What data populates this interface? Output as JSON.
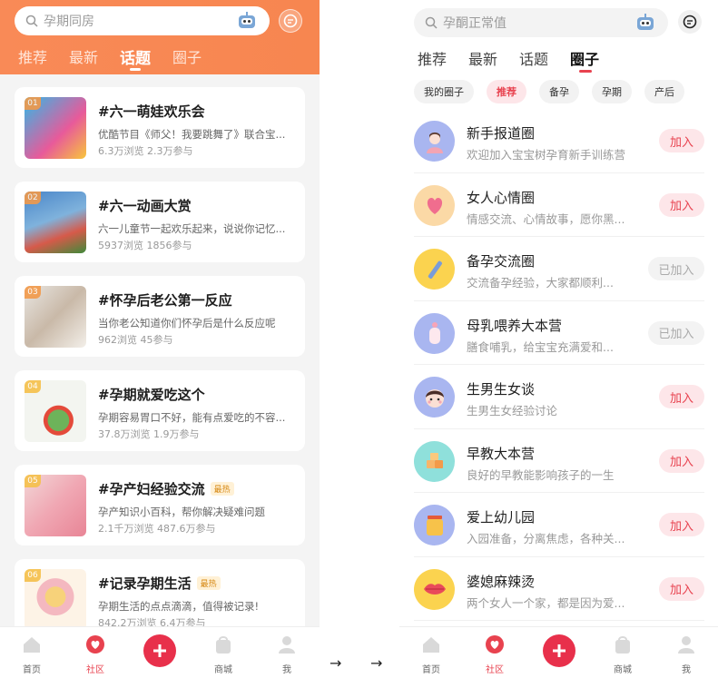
{
  "left": {
    "search_placeholder": "孕期同房",
    "tabs": [
      "推荐",
      "最新",
      "话题",
      "圈子"
    ],
    "topics": [
      {
        "rank": "01",
        "title": "#六一萌娃欢乐会",
        "desc": "优酷节目《师父！我要跳舞了》联合宝...",
        "stats": "6.3万浏览  2.3万参与",
        "badge": ""
      },
      {
        "rank": "02",
        "title": "#六一动画大赏",
        "desc": "六一儿童节一起欢乐起来，说说你记忆...",
        "stats": "5937浏览  1856参与",
        "badge": ""
      },
      {
        "rank": "03",
        "title": "#怀孕后老公第一反应",
        "desc": "当你老公知道你们怀孕后是什么反应呢",
        "stats": "962浏览  45参与",
        "badge": ""
      },
      {
        "rank": "04",
        "title": "#孕期就爱吃这个",
        "desc": "孕期容易胃口不好，能有点爱吃的不容...",
        "stats": "37.8万浏览  1.9万参与",
        "badge": ""
      },
      {
        "rank": "05",
        "title": "#孕产妇经验交流",
        "desc": "孕产知识小百科，帮你解决疑难问题",
        "stats": "2.1千万浏览  487.6万参与",
        "badge": "最热"
      },
      {
        "rank": "06",
        "title": "#记录孕期生活",
        "desc": "孕期生活的点点滴滴，值得被记录!",
        "stats": "842.2万浏览  6.4万参与",
        "badge": "最热"
      }
    ]
  },
  "right": {
    "search_placeholder": "孕酮正常值",
    "tabs": [
      "推荐",
      "最新",
      "话题",
      "圈子"
    ],
    "chips": [
      "我的圈子",
      "推荐",
      "备孕",
      "孕期",
      "产后"
    ],
    "groups": [
      {
        "name": "新手报道圈",
        "desc": "欢迎加入宝宝树孕育新手训练营",
        "button": "加入",
        "avatar": "mom-avatar-icon"
      },
      {
        "name": "女人心情圈",
        "desc": "情感交流、心情故事，愿你黑...",
        "button": "加入",
        "avatar": "heart-icon"
      },
      {
        "name": "备孕交流圈",
        "desc": "交流备孕经验，大家都顺利...",
        "button": "已加入",
        "avatar": "test-strip-icon"
      },
      {
        "name": "母乳喂养大本营",
        "desc": "膳食哺乳，给宝宝充满爱和...",
        "button": "已加入",
        "avatar": "bottle-icon"
      },
      {
        "name": "生男生女谈",
        "desc": "生男生女经验讨论",
        "button": "加入",
        "avatar": "girl-face-icon"
      },
      {
        "name": "早教大本营",
        "desc": "良好的早教能影响孩子的一生",
        "button": "加入",
        "avatar": "blocks-icon"
      },
      {
        "name": "爱上幼儿园",
        "desc": "入园准备，分离焦虑，各种关...",
        "button": "加入",
        "avatar": "jar-icon"
      },
      {
        "name": "婆媳麻辣烫",
        "desc": "两个女人一个家，都是因为爱...",
        "button": "加入",
        "avatar": "lips-icon"
      }
    ]
  },
  "nav": {
    "home": "首页",
    "community": "社区",
    "mall": "商城",
    "me": "我"
  },
  "arrows": [
    "→",
    "→"
  ],
  "colors": {
    "accent": "#e8424f",
    "header_orange": "#f98a57"
  }
}
